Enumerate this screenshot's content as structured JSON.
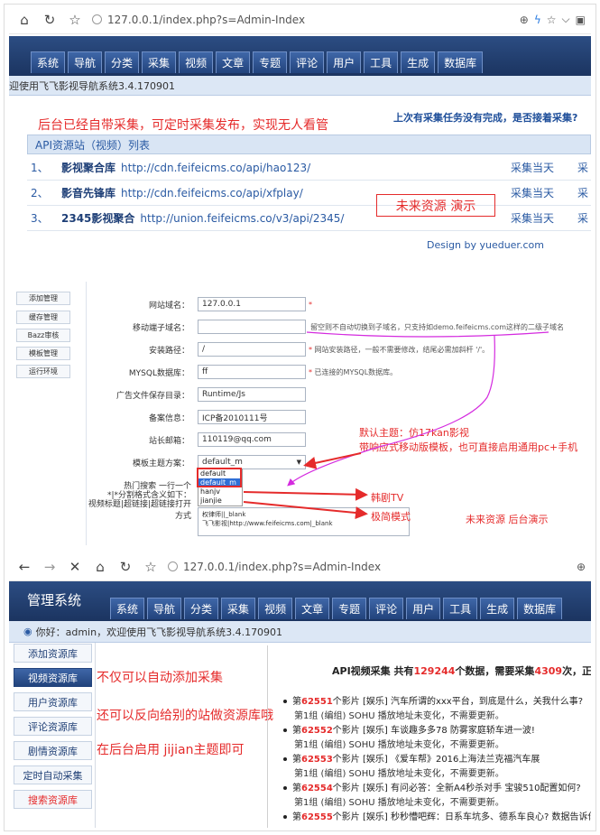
{
  "browser1": {
    "url": "127.0.0.1/index.php?s=Admin-Index"
  },
  "nav1": {
    "tabs": [
      "系统",
      "导航",
      "分类",
      "采集",
      "视频",
      "文章",
      "专题",
      "评论",
      "用户",
      "工具",
      "生成",
      "数据库"
    ],
    "welcome": "迎使用飞飞影视导航系统3.4.170901"
  },
  "section1": {
    "note": "后台已经自带采集，可定时采集发布，实现无人看管",
    "resume": "上次有采集任务没有完成，是否接着采集?",
    "list_title": "API资源站（视频）列表",
    "rows": [
      {
        "num": "1、",
        "name": "影视聚合库",
        "url": "http://cdn.feifeicms.co/api/hao123/",
        "action": "采集当天",
        "action2": "采"
      },
      {
        "num": "2、",
        "name": "影音先锋库",
        "url": "http://cdn.feifeicms.co/api/xfplay/",
        "action": "采集当天",
        "action2": "采"
      },
      {
        "num": "3、",
        "name": "2345影视聚合",
        "url": "http://union.feifeicms.co/v3/api/2345/",
        "action": "采集当天",
        "action2": "采"
      }
    ],
    "demo_box": "未来资源  演示",
    "design": "Design by yueduer.com"
  },
  "section2": {
    "side": [
      "添加管理",
      "缓存管理",
      "Bazz审核",
      "模板管理",
      "运行环境"
    ],
    "fields": [
      {
        "label": "网站域名：",
        "value": "127.0.0.1",
        "hint": ""
      },
      {
        "label": "移动端子域名：",
        "value": "",
        "hint": "留空则不自动切换到子域名，只支持如demo.feifeicms.com这样的二级子域名"
      },
      {
        "label": "安装路径：",
        "value": "/",
        "hint": "网站安装路径，一般不需要修改，结尾必需加斜杆 '/'。"
      },
      {
        "label": "MYSQL数据库：",
        "value": "ff",
        "hint": "已连接的MYSQL数据库。"
      },
      {
        "label": "广告文件保存目录：",
        "value": "Runtime/Js",
        "hint": ""
      },
      {
        "label": "备案信息：",
        "value": "ICP备2010111号",
        "hint": ""
      },
      {
        "label": "站长邮箱：",
        "value": "110119@qq.com",
        "hint": ""
      }
    ],
    "theme_label": "模板主题方案：",
    "theme_value": "default_m",
    "theme_options": [
      "default",
      "default_m",
      "hanjv",
      "jianjie"
    ],
    "hot_label1": "热门搜索 一行一个",
    "hot_label2": "*|*分割格式含义如下：",
    "hot_label3": "视频标题|超链接|超链接打开方式",
    "textarea_line1": "权律师||_blank",
    "textarea_line2": "飞飞影视|http://www.feifeicms.com|_blank",
    "annot_default": "默认主题：仿17kan影视",
    "annot_mobile": "带响应式移动版模板，也可直接启用通用pc+手机",
    "annot_hanju": "韩剧TV",
    "annot_jianjie": "极简模式",
    "annot_future": "未来资源 后台演示"
  },
  "browser2": {
    "url": "127.0.0.1/index.php?s=Admin-Index"
  },
  "section3": {
    "title": "管理系统",
    "tabs": [
      "系统",
      "导航",
      "分类",
      "采集",
      "视频",
      "文章",
      "专题",
      "评论",
      "用户",
      "工具",
      "生成",
      "数据库"
    ],
    "welcome": "你好：admin，欢迎使用飞飞影视导航系统3.4.170901",
    "side": [
      "添加资源库",
      "视频资源库",
      "用户资源库",
      "评论资源库",
      "剧情资源库",
      "定时自动采集",
      "搜索资源库"
    ],
    "note1": "不仅可以自动添加采集",
    "note2": "还可以反向给别的站做资源库哦",
    "note3": "在后台启用 jijian主题即可",
    "panel_title": {
      "a": "API视频采集 共有",
      "total": "129244",
      "b": "个数据，需要采集",
      "need": "4309",
      "c": "次，正在"
    },
    "items": [
      {
        "pre": "第",
        "num": "62551",
        "text": "个影片 [娱乐] 汽车所谓的xxx平台，到底是什么，关我什么事?"
      },
      {
        "pre": "第",
        "num": "62552",
        "text": "个影片 [娱乐] 车谈趣多多78 防雾家庭轿车进一波!"
      },
      {
        "pre": "第",
        "num": "62553",
        "text": "个影片 [娱乐] 《爱车帮》2016上海法兰克福汽车展"
      },
      {
        "pre": "第",
        "num": "62554",
        "text": "个影片 [娱乐] 有问必答：全新A4秒杀对手 宝骏510配置如何?"
      },
      {
        "pre": "第",
        "num": "62555",
        "text": "个影片 [娱乐] 秒秒懵吧辉：日系车坑多、德系车良心? 数据告诉你"
      }
    ],
    "sub": "第1组 (编组) SOHU 播放地址未变化，不需要更新。"
  },
  "colors": {
    "nav": "#1b3460",
    "accent": "#2a5aa3",
    "red": "#e52b2b",
    "magenta": "#d42adf"
  }
}
